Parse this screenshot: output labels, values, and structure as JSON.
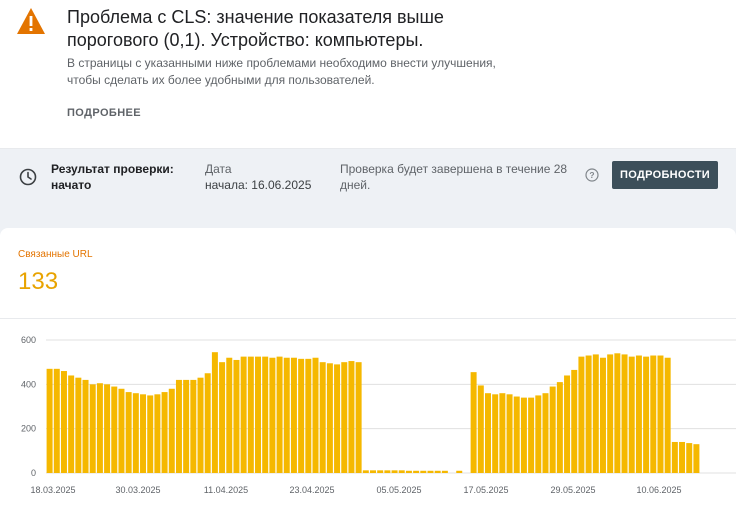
{
  "issue": {
    "title": "Проблема с CLS: значение показателя выше порогового (0,1). Устройство: компьютеры.",
    "description": "В страницы с указанными ниже проблемами необходимо внести улучшения, чтобы сделать их более удобными для пользователей.",
    "learn_more": "ПОДРОБНЕЕ",
    "icon": "warning-icon",
    "accent": "#e37400"
  },
  "validation": {
    "status": "Результат проверки: начато",
    "date_label": "Дата",
    "date_value": "начала: 16.06.2025",
    "note": "Проверка будет завершена в течение 28 дней.",
    "details_button": "ПОДРОБНОСТИ",
    "icon": "clock-icon",
    "help_icon": "help-icon"
  },
  "summary": {
    "label": "Связанные URL",
    "value": "133"
  },
  "chart_data": {
    "type": "bar",
    "color": "#f5b800",
    "ylim": [
      0,
      600
    ],
    "yticks": [
      0,
      200,
      400,
      600
    ],
    "xticks": [
      "18.03.2025",
      "30.03.2025",
      "11.04.2025",
      "23.04.2025",
      "05.05.2025",
      "17.05.2025",
      "29.05.2025",
      "10.06.2025"
    ],
    "values": [
      470,
      470,
      460,
      440,
      430,
      420,
      400,
      405,
      400,
      390,
      380,
      365,
      360,
      355,
      350,
      355,
      365,
      380,
      420,
      420,
      420,
      430,
      450,
      545,
      500,
      520,
      510,
      525,
      525,
      525,
      525,
      520,
      525,
      520,
      520,
      515,
      515,
      520,
      500,
      495,
      490,
      500,
      505,
      500,
      12,
      12,
      12,
      12,
      12,
      12,
      10,
      10,
      10,
      10,
      10,
      10,
      0,
      10,
      0,
      455,
      395,
      360,
      355,
      360,
      355,
      345,
      340,
      340,
      350,
      360,
      390,
      410,
      440,
      465,
      525,
      530,
      535,
      520,
      535,
      540,
      535,
      525,
      530,
      525,
      530,
      530,
      520,
      140,
      140,
      135,
      130
    ]
  }
}
